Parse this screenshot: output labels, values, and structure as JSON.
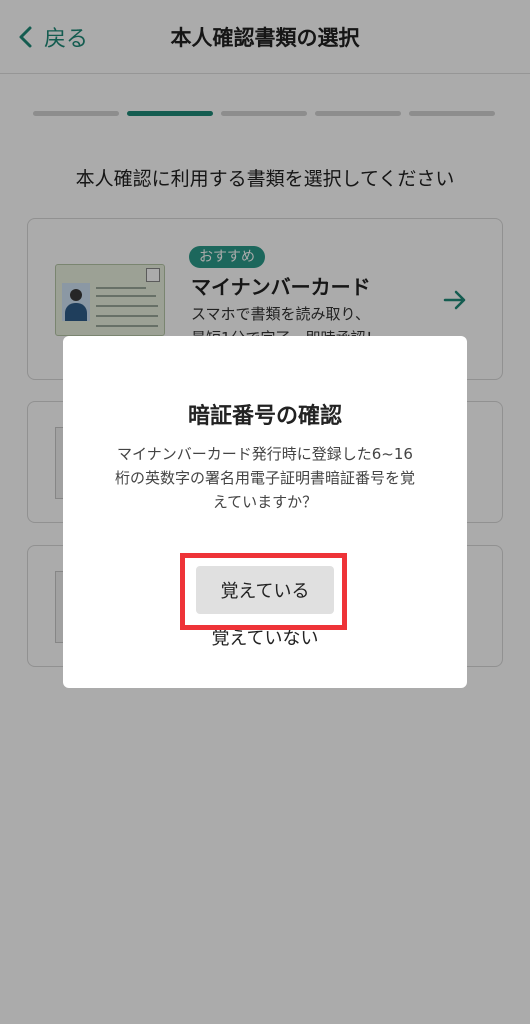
{
  "header": {
    "back_label": "戻る",
    "title": "本人確認書類の選択"
  },
  "progress": {
    "total": 5,
    "current": 2
  },
  "instruction": "本人確認に利用する書類を選択してください",
  "cards": [
    {
      "badge": "おすすめ",
      "title": "マイナンバーカード",
      "desc_line1": "スマホで書類を読み取り、",
      "desc_line2": "最短1分で完了。即時承認！"
    }
  ],
  "dialog": {
    "title": "暗証番号の確認",
    "message_line1": "マイナンバーカード発行時に登録した6~16",
    "message_line2": "桁の英数字の署名用電子証明書暗証番号を覚",
    "message_line3": "えていますか？",
    "primary_button": "覚えている",
    "secondary_button": "覚えていない"
  },
  "colors": {
    "accent": "#1f8a78",
    "highlight": "#ee3338"
  }
}
